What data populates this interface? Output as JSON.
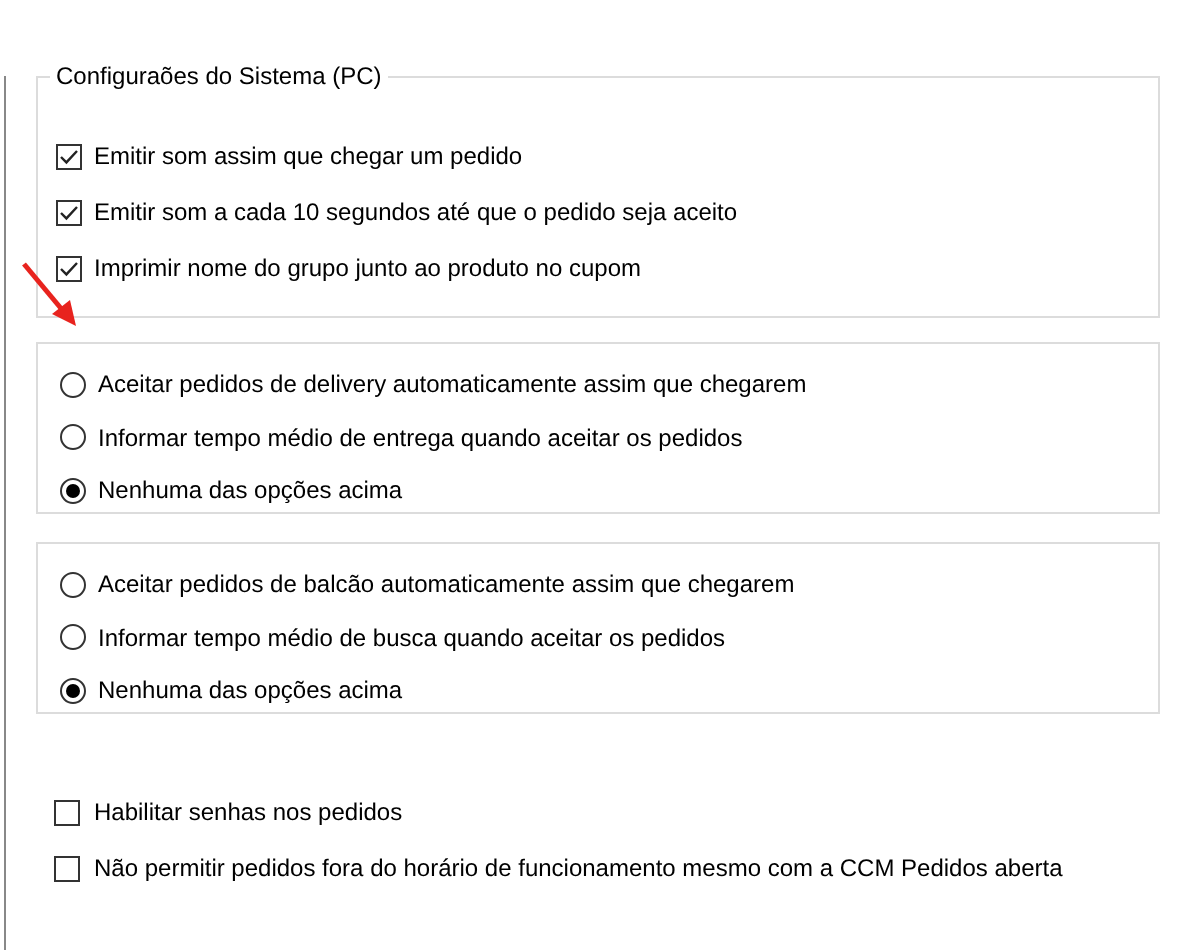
{
  "system_group": {
    "title": "Configuraões do Sistema (PC)",
    "options": [
      {
        "label": "Emitir som assim que chegar um pedido",
        "checked": true
      },
      {
        "label": "Emitir som a cada 10 segundos até que o pedido seja aceito",
        "checked": true
      },
      {
        "label": "Imprimir nome do grupo junto ao produto no cupom",
        "checked": true
      }
    ]
  },
  "delivery_group": {
    "options": [
      {
        "label": "Aceitar pedidos de delivery automaticamente assim que chegarem",
        "selected": false
      },
      {
        "label": "Informar tempo médio de entrega quando aceitar os pedidos",
        "selected": false
      },
      {
        "label": "Nenhuma das opções acima",
        "selected": true
      }
    ]
  },
  "counter_group": {
    "options": [
      {
        "label": "Aceitar pedidos de balcão automaticamente assim que chegarem",
        "selected": false
      },
      {
        "label": "Informar tempo médio de busca quando aceitar os pedidos",
        "selected": false
      },
      {
        "label": "Nenhuma das opções acima",
        "selected": true
      }
    ]
  },
  "options": [
    {
      "label": "Habilitar senhas nos pedidos",
      "checked": false
    },
    {
      "label": "Não permitir pedidos fora do horário de funcionamento mesmo com a CCM Pedidos aberta",
      "checked": false
    }
  ]
}
